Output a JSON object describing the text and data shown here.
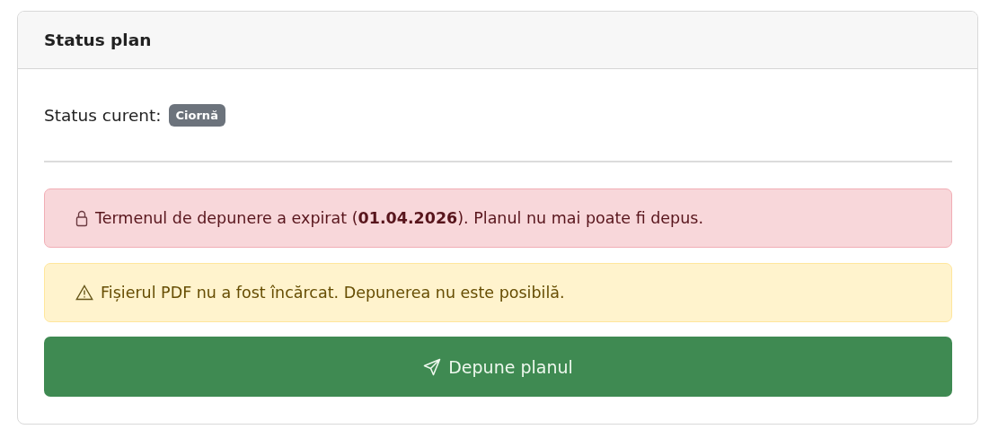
{
  "card": {
    "title": "Status plan"
  },
  "status": {
    "label": "Status curent:",
    "badge": "Ciornă"
  },
  "alerts": [
    {
      "kind": "danger",
      "text": "Termenul de depunere a expirat (**01.04.2026**). Planul nu mai poate fi depus."
    },
    {
      "kind": "warning",
      "text": "Fișierul PDF nu a fost încărcat. Depunerea nu este posibilă."
    }
  ],
  "submit_button": {
    "label": "Depune planul"
  }
}
